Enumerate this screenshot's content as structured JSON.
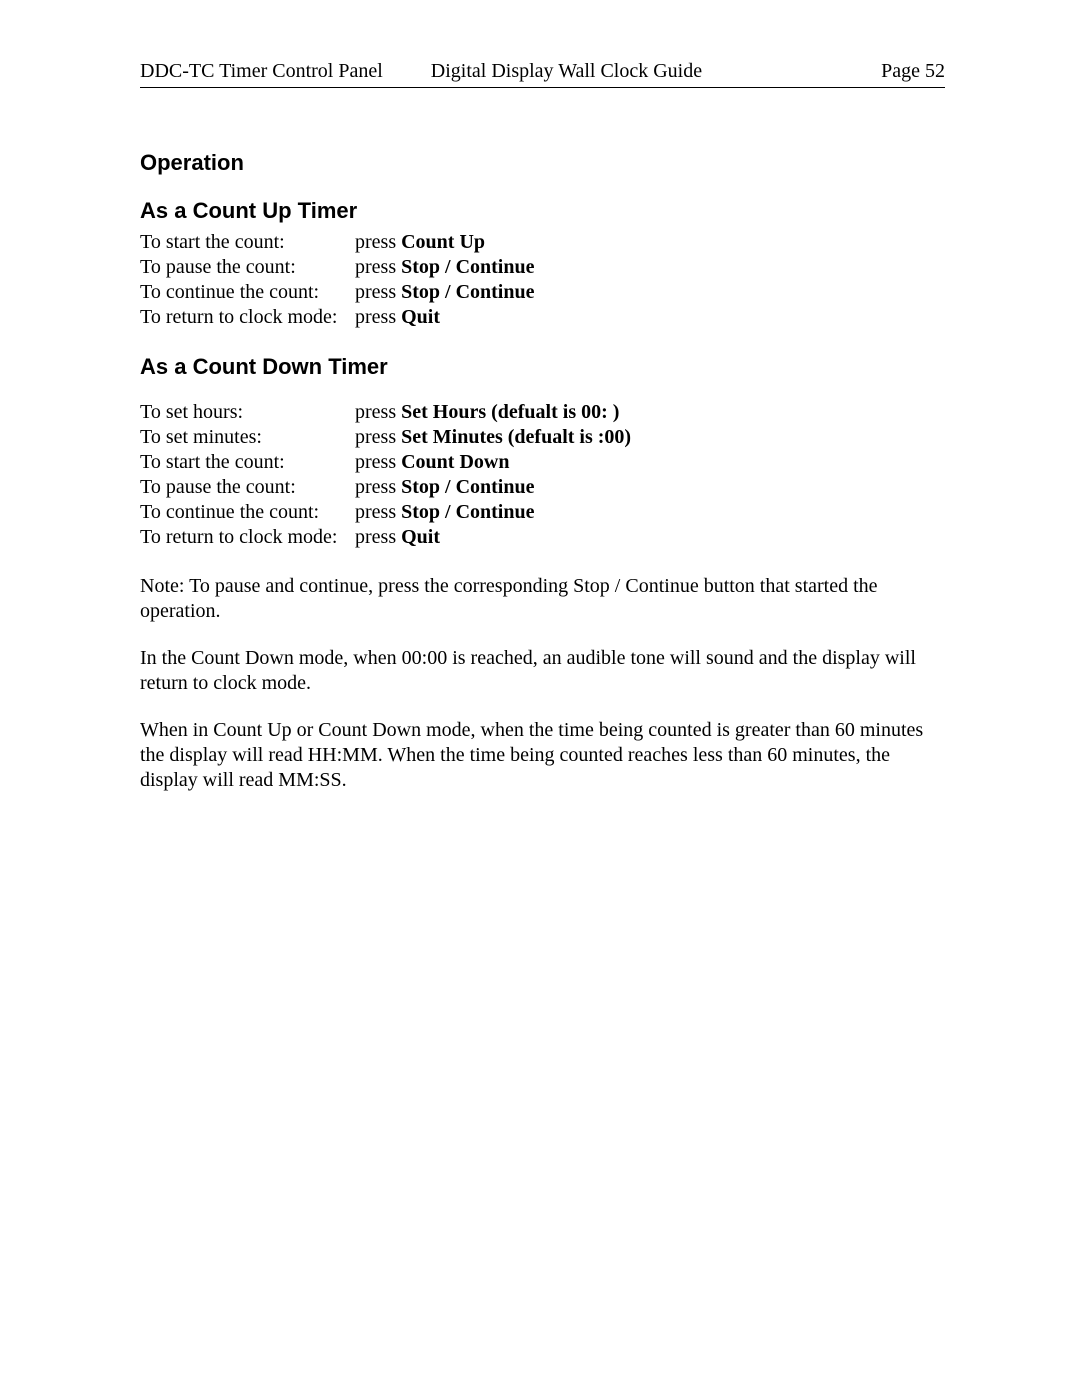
{
  "header": {
    "left1": "DDC-TC Timer Control Panel",
    "left2": "Digital Display Wall Clock Guide",
    "page": "Page 52"
  },
  "section_title": "Operation",
  "count_up": {
    "heading": "As a Count Up Timer",
    "rows": [
      {
        "label": "To start the count:",
        "prefix": "press ",
        "bold": "Count Up"
      },
      {
        "label": "To pause the count:",
        "prefix": "press ",
        "bold": "Stop / Continue"
      },
      {
        "label": "To continue the count:",
        "prefix": "press ",
        "bold": "Stop / Continue"
      },
      {
        "label": "To return to clock mode:",
        "prefix": "press ",
        "bold": "Quit"
      }
    ]
  },
  "count_down": {
    "heading": "As a Count Down Timer",
    "rows": [
      {
        "label": "To set hours:",
        "prefix": "press ",
        "bold": "Set Hours (defualt is 00: )"
      },
      {
        "label": "To set minutes:",
        "prefix": "press ",
        "bold": "Set Minutes (defualt is :00)"
      },
      {
        "label": "To start the count:",
        "prefix": "press ",
        "bold": "Count Down"
      },
      {
        "label": "To pause the count:",
        "prefix": "press ",
        "bold": "Stop / Continue"
      },
      {
        "label": "To continue the count:",
        "prefix": "press ",
        "bold": "Stop / Continue"
      },
      {
        "label": "To return to clock mode:",
        "prefix": "press ",
        "bold": "Quit"
      }
    ]
  },
  "paragraphs": [
    "Note: To pause and continue, press the corresponding Stop / Continue button that started the operation.",
    "In the Count Down mode, when 00:00 is reached, an audible tone will sound and the display will return to clock mode.",
    "When in Count Up or Count Down mode, when the time being counted is greater than 60 minutes the display will read HH:MM. When the time being counted reaches less than 60 minutes, the display will read MM:SS."
  ]
}
